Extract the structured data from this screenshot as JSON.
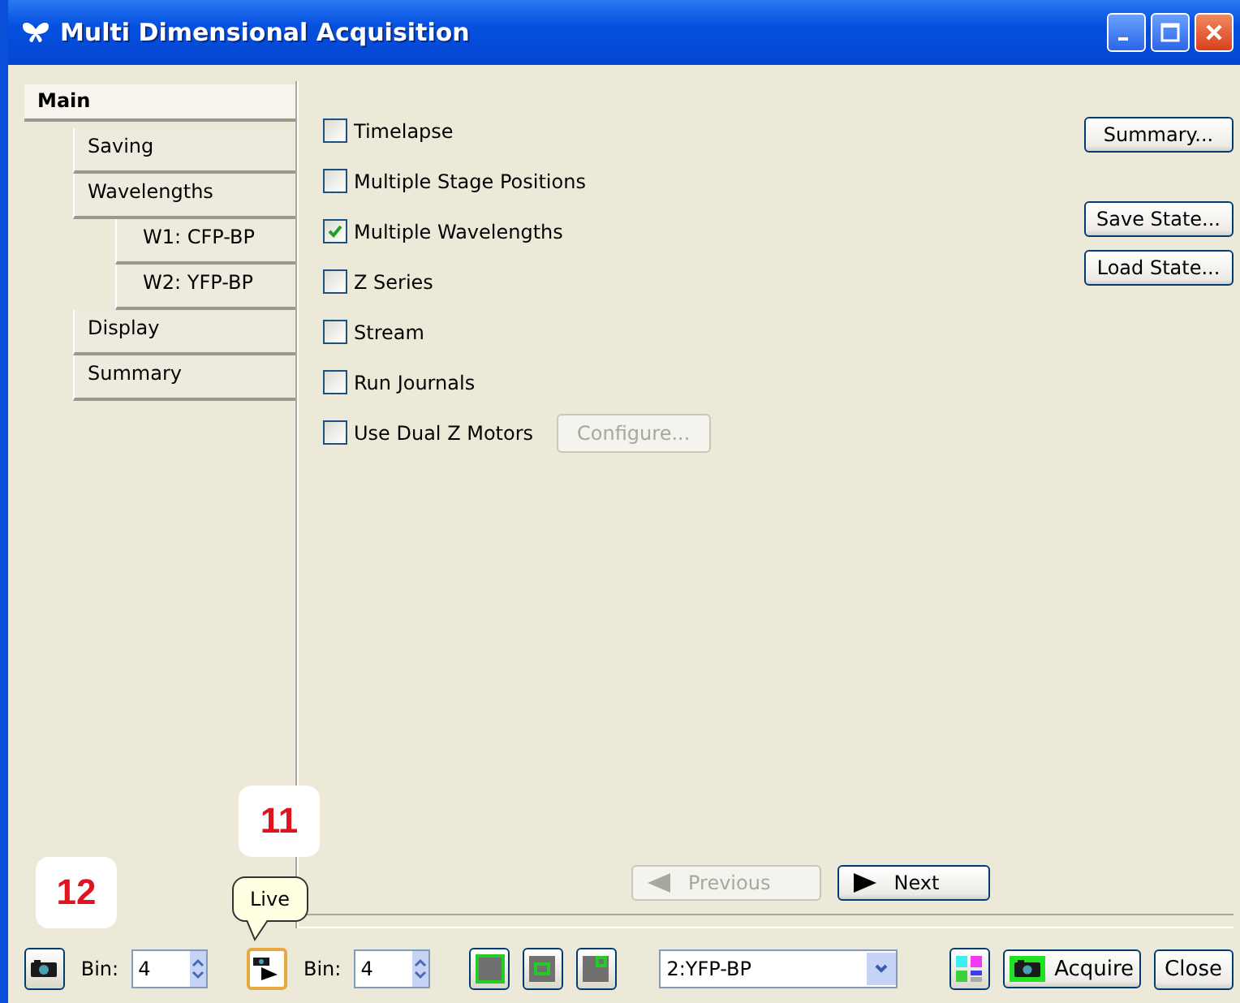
{
  "window": {
    "title": "Multi Dimensional Acquisition"
  },
  "sidebar": {
    "header": {
      "label": "Main",
      "selected": true
    },
    "items": [
      {
        "label": "Saving",
        "selected": false
      },
      {
        "label": "Wavelengths",
        "selected": false,
        "children": [
          {
            "label": "W1: CFP-BP",
            "selected": false
          },
          {
            "label": "W2: YFP-BP",
            "selected": false
          }
        ]
      },
      {
        "label": "Display",
        "selected": false
      },
      {
        "label": "Summary",
        "selected": false
      }
    ]
  },
  "options": [
    {
      "label": "Timelapse",
      "checked": false
    },
    {
      "label": "Multiple Stage Positions",
      "checked": false
    },
    {
      "label": "Multiple Wavelengths",
      "checked": true
    },
    {
      "label": "Z Series",
      "checked": false
    },
    {
      "label": "Stream",
      "checked": false
    },
    {
      "label": "Run Journals",
      "checked": false
    },
    {
      "label": "Use Dual Z Motors",
      "checked": false,
      "button": {
        "label": "Configure...",
        "disabled": true
      }
    }
  ],
  "side_buttons": [
    {
      "label": "Summary..."
    },
    {
      "label": "Save State..."
    },
    {
      "label": "Load State..."
    }
  ],
  "nav": [
    {
      "label": "Previous",
      "kind": "back",
      "disabled": true
    },
    {
      "label": "Next",
      "kind": "forward",
      "disabled": false
    }
  ],
  "toolbar": {
    "snap_bin": {
      "label": "Bin:",
      "value": "4"
    },
    "live_bin": {
      "label": "Bin:",
      "value": "4"
    },
    "live_pressed": true,
    "wavelength": "2:YFP-BP",
    "acquire": "Acquire",
    "close": "Close"
  },
  "tooltip": "Live",
  "callouts": [
    {
      "label": "11",
      "kind": "live"
    },
    {
      "label": "12",
      "kind": "snap"
    }
  ]
}
